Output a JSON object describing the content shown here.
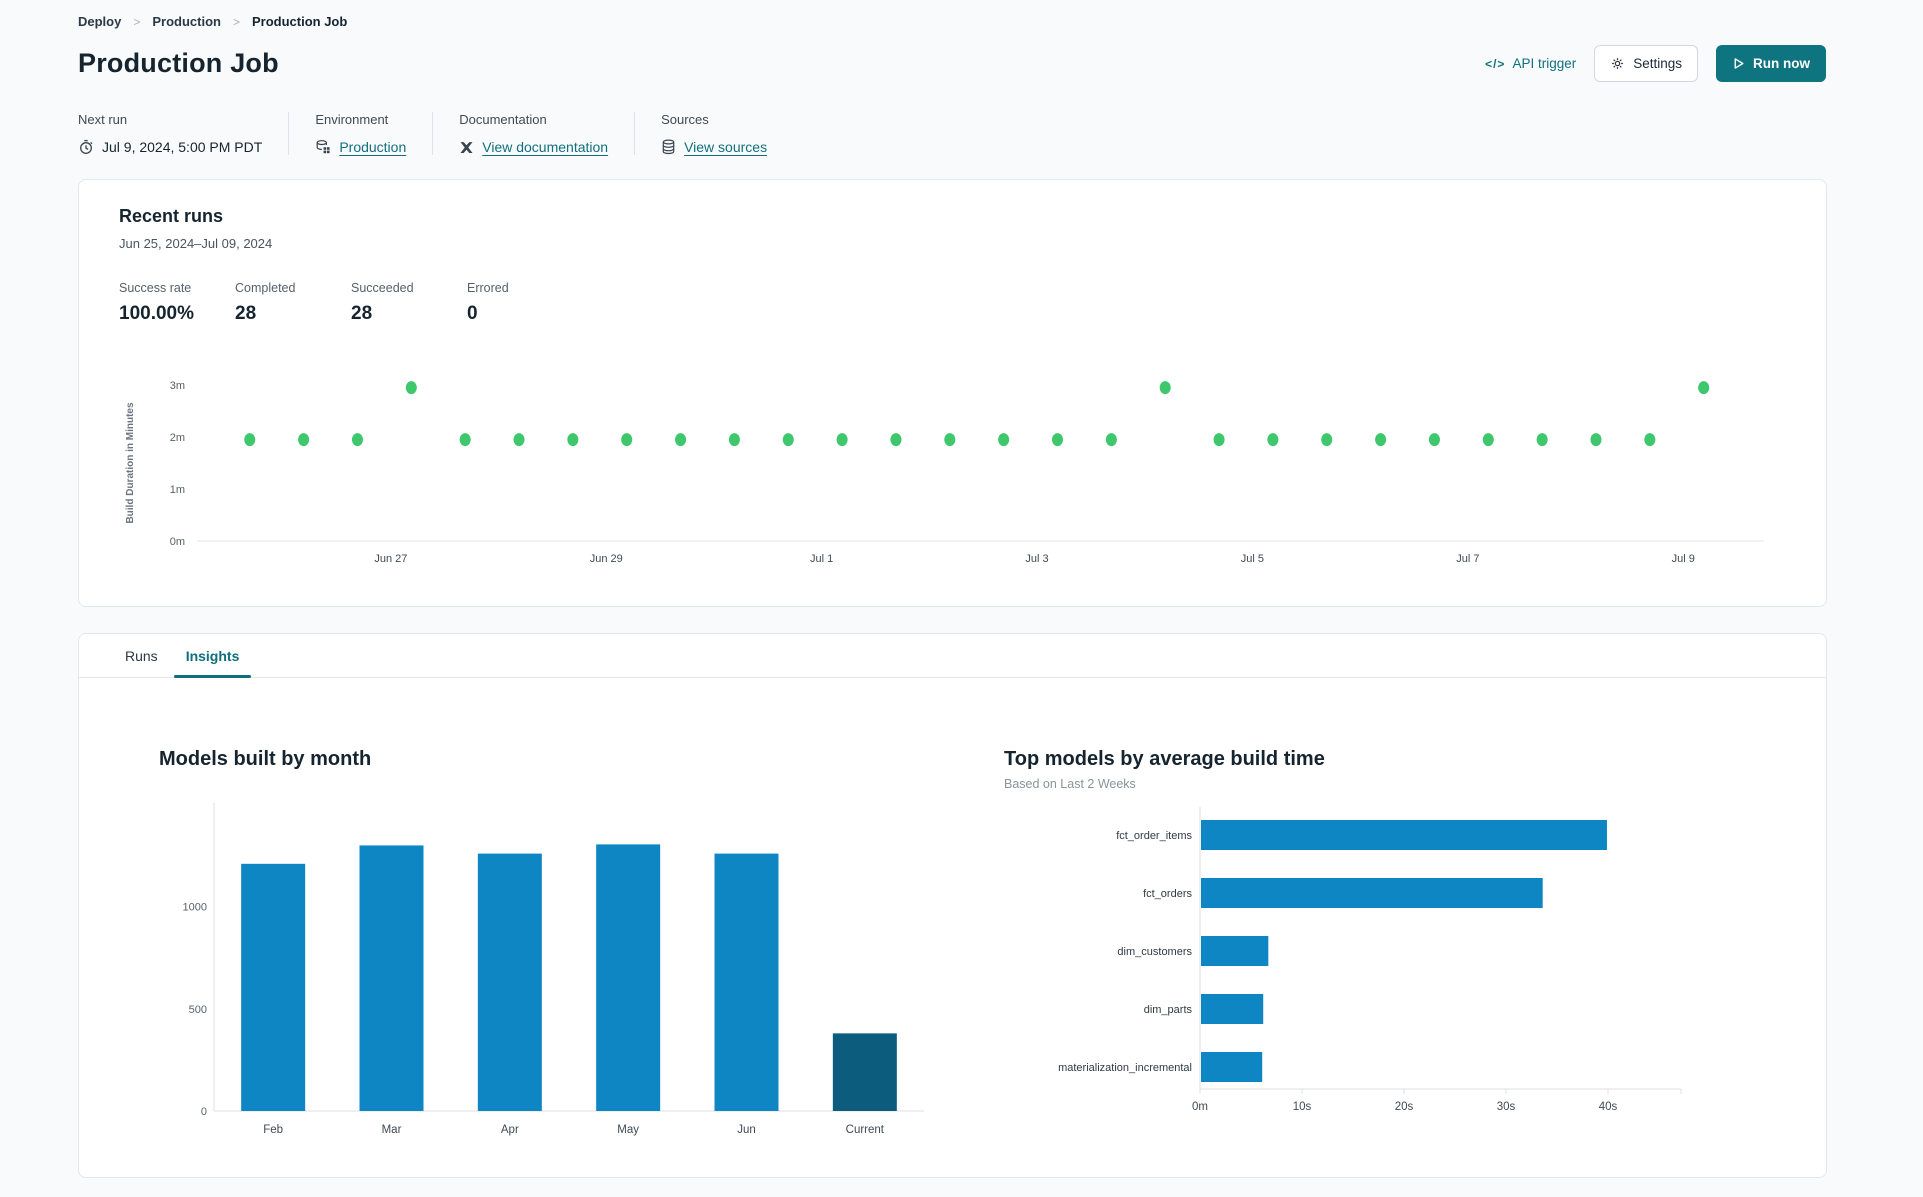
{
  "breadcrumb": {
    "items": [
      "Deploy",
      "Production",
      "Production Job"
    ]
  },
  "header": {
    "title": "Production Job",
    "api_trigger_label": "API trigger",
    "api_trigger_glyph": "</>",
    "settings_label": "Settings",
    "run_now_label": "Run now"
  },
  "info": {
    "next_run": {
      "label": "Next run",
      "value": "Jul 9, 2024, 5:00 PM PDT",
      "icon": "clock-icon"
    },
    "environment": {
      "label": "Environment",
      "value": "Production",
      "icon": "environment-icon"
    },
    "documentation": {
      "label": "Documentation",
      "value": "View documentation",
      "icon": "docs-icon"
    },
    "sources": {
      "label": "Sources",
      "value": "View sources",
      "icon": "database-icon"
    }
  },
  "recent_runs": {
    "title": "Recent runs",
    "date_range": "Jun 25, 2024–Jul 09, 2024",
    "stats": [
      {
        "label": "Success rate",
        "value": "100.00%"
      },
      {
        "label": "Completed",
        "value": "28"
      },
      {
        "label": "Succeeded",
        "value": "28"
      },
      {
        "label": "Errored",
        "value": "0"
      }
    ]
  },
  "tabs": [
    {
      "label": "Runs",
      "active": false
    },
    {
      "label": "Insights",
      "active": true
    }
  ],
  "colors": {
    "accent_teal": "#0e7480",
    "link_teal": "#11707e",
    "bar_blue": "#0e86c4",
    "bar_dark_teal": "#0c5d7d",
    "dot_green": "#3ec76d",
    "axis_gray": "#dcdfe2",
    "tick_text": "#3f4a54"
  },
  "chart_data": [
    {
      "id": "build-duration-scatter",
      "type": "scatter",
      "ylabel": "Build Duration in Minutes",
      "x_tick_labels": [
        "Jun 27",
        "Jun 29",
        "Jul 1",
        "Jul 3",
        "Jul 5",
        "Jul 7",
        "Jul 9"
      ],
      "x_tick_days": [
        2,
        4,
        6,
        8,
        10,
        12,
        14
      ],
      "x_domain_days": [
        0.2,
        14.75
      ],
      "y_ticks": [
        "0m",
        "1m",
        "2m",
        "3m"
      ],
      "y_tick_values": [
        0,
        1,
        2,
        3
      ],
      "ylim": [
        0,
        3.3
      ],
      "point_color": "#3ec76d",
      "points": {
        "start_day": 0.69,
        "step_day": 0.5,
        "minutes": [
          1.95,
          1.95,
          1.95,
          2.95,
          1.95,
          1.95,
          1.95,
          1.95,
          1.95,
          1.95,
          1.95,
          1.95,
          1.95,
          1.95,
          1.95,
          1.95,
          1.95,
          2.95,
          1.95,
          1.95,
          1.95,
          1.95,
          1.95,
          1.95,
          1.95,
          1.95,
          1.95,
          2.95
        ]
      }
    },
    {
      "id": "models-built-by-month",
      "type": "bar",
      "title": "Models built by month",
      "categories": [
        "Feb",
        "Mar",
        "Apr",
        "May",
        "Jun",
        "Current"
      ],
      "values": [
        1210,
        1300,
        1260,
        1305,
        1260,
        380
      ],
      "y_ticks": [
        0,
        500,
        1000
      ],
      "ylim": [
        0,
        1400
      ],
      "bar_color": "#0e86c4",
      "highlight_color": "#0c5d7d",
      "highlight_index": 5
    },
    {
      "id": "top-models-by-build-time",
      "type": "hbar",
      "title": "Top models by average build time",
      "subtitle": "Based on Last 2 Weeks",
      "categories": [
        "fct_order_items",
        "fct_orders",
        "dim_customers",
        "dim_parts",
        "materialization_incremental"
      ],
      "values_seconds": [
        39.8,
        33.5,
        6.6,
        6.1,
        6.0
      ],
      "x_ticks": [
        {
          "v": 0,
          "label": "0m"
        },
        {
          "v": 10,
          "label": "10s"
        },
        {
          "v": 20,
          "label": "20s"
        },
        {
          "v": 30,
          "label": "30s"
        },
        {
          "v": 40,
          "label": "40s"
        }
      ],
      "xlim": [
        0,
        45
      ],
      "bar_color": "#0e86c4"
    }
  ]
}
